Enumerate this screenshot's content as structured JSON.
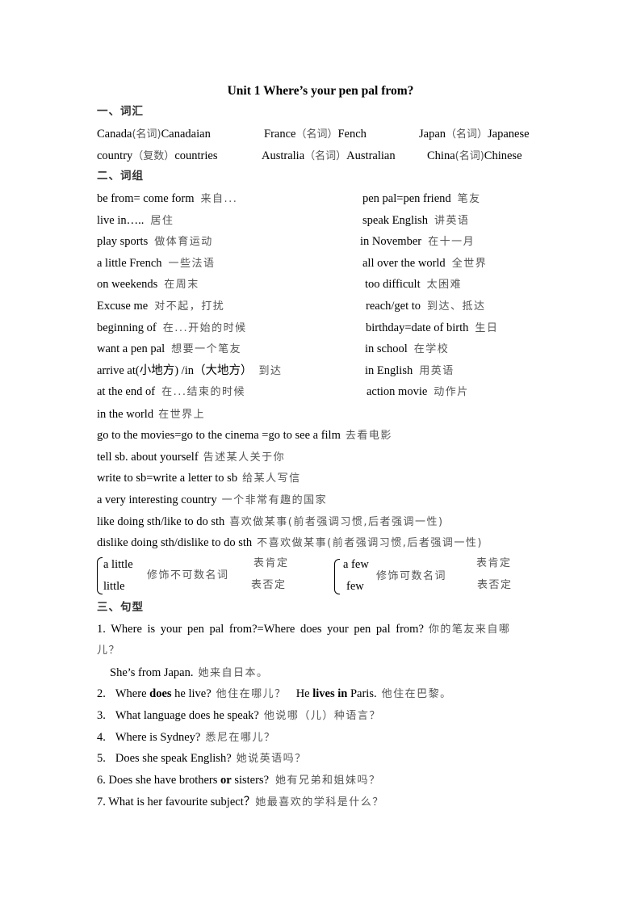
{
  "title": "Unit 1 Where’s your pen pal from?",
  "sections": {
    "vocab": {
      "heading": "一、词汇",
      "rows": [
        [
          {
            "en": "Canada",
            "zh": "(名词)",
            "en2": "Canadaian"
          },
          {
            "en": "France",
            "zh": "（名词）",
            "en2": "Fench"
          },
          {
            "en": "Japan",
            "zh": "（名词）",
            "en2": "Japanese"
          }
        ],
        [
          {
            "en": "country",
            "zh": "（复数）",
            "en2": "countries"
          },
          {
            "en": "Australia",
            "zh": "（名词）",
            "en2": "Australian"
          },
          {
            "en": "China",
            "zh": "(名词)",
            "en2": "Chinese"
          }
        ]
      ]
    },
    "phrases": {
      "heading": "二、词组",
      "pairs": [
        {
          "left_en": "be from= come form",
          "left_zh": "来自...",
          "right_en": "pen pal=pen friend",
          "right_zh": "笔友"
        },
        {
          "left_en": "live in…..",
          "left_zh": "居住",
          "right_en": "speak English",
          "right_zh": "讲英语"
        },
        {
          "left_en": "play sports",
          "left_zh": "做体育运动",
          "right_en": "in November",
          "right_zh": "在十一月"
        },
        {
          "left_en": "a little French",
          "left_zh": "一些法语",
          "right_en": "all over the world",
          "right_zh": "全世界"
        },
        {
          "left_en": "on weekends",
          "left_zh": "在周末",
          "right_en": "too difficult",
          "right_zh": "太困难"
        },
        {
          "left_en": "Excuse me",
          "left_zh": "对不起，打扰",
          "right_en": "reach/get to",
          "right_zh": "到达、抵达"
        },
        {
          "left_en": "beginning of",
          "left_zh": "在...开始的时候",
          "right_en": "birthday=date of birth",
          "right_zh": "生日"
        },
        {
          "left_en": "want a pen pal",
          "left_zh": "想要一个笔友",
          "right_en": "in school",
          "right_zh": "在学校"
        },
        {
          "left_en": "arrive at(小地方) /in（大地方）",
          "left_zh": "到达",
          "right_en": "in English",
          "right_zh": "用英语"
        },
        {
          "left_en": "at the end of",
          "left_zh": "在...结束的时候",
          "right_en": "action movie",
          "right_zh": "动作片"
        }
      ],
      "singles": [
        {
          "en": "in the world",
          "zh": "在世界上"
        },
        {
          "en": "go to the movies=go to the cinema =go to see a film",
          "zh": "去看电影"
        },
        {
          "en": "tell sb. about yourself",
          "zh": "告述某人关于你"
        },
        {
          "en": "write to sb=write a letter to sb",
          "zh": "给某人写信"
        },
        {
          "en": "a very interesting country",
          "zh": "一个非常有趣的国家"
        },
        {
          "en": "like doing sth/like to do sth",
          "zh": "喜欢做某事(前者强调习惯,后者强调一性)"
        },
        {
          "en": "dislike doing sth/dislike to do sth",
          "zh": "不喜欢做某事(前者强调习惯,后者强调一性)"
        }
      ],
      "brace_groups": [
        {
          "top": "a little",
          "bottom": "little",
          "middle": "修饰不可数名词",
          "top_note": "表肯定",
          "bottom_note": "表否定"
        },
        {
          "top": "a few",
          "bottom": "few",
          "middle": "修饰可数名词",
          "top_note": "表肯定",
          "bottom_note": "表否定"
        }
      ]
    },
    "sentences": {
      "heading": "三、句型",
      "s1": {
        "en": "1. Where is your pen pal from?=Where does your pen pal from?",
        "zh": "你的笔友来自哪",
        "wrap": "儿？"
      },
      "s1_answer": {
        "en": "She’s from Japan.",
        "zh": "她来自日本。"
      },
      "s2": {
        "num": "2.",
        "q_a": "Where ",
        "q_b": "does",
        "q_c": " he live?",
        "q_zh": "他住在哪儿？",
        "a_a": "He ",
        "a_b": "lives in",
        "a_c": " Paris.",
        "a_zh": "他住在巴黎。"
      },
      "s3": {
        "num": "3.",
        "en": "What language does he speak?",
        "zh": "他说哪（儿）种语言？"
      },
      "s4": {
        "num": "4.",
        "en": "Where is Sydney?",
        "zh": "悉尼在哪儿？"
      },
      "s5": {
        "num": "5.",
        "en": "Does she speak English?",
        "zh": "她说英语吗？"
      },
      "s6": {
        "a": "6. Does she have brothers ",
        "b": "or",
        "c": " sisters?",
        "zh": "她有兄弟和姐妹吗？"
      },
      "s7": {
        "en": "7. What is her favourite subject？",
        "zh": "她最喜欢的学科是什么？"
      }
    }
  }
}
